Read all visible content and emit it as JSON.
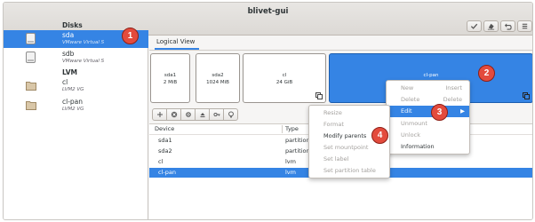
{
  "window": {
    "title": "blivet-gui"
  },
  "headerbar_buttons": [
    {
      "name": "apply-icon"
    },
    {
      "name": "clear-queue-icon"
    },
    {
      "name": "undo-icon"
    },
    {
      "name": "menu-icon"
    }
  ],
  "sidebar": {
    "disks_heading": "Disks",
    "lvm_heading": "LVM",
    "disks": [
      {
        "name": "sda",
        "sub": "VMware Virtual S",
        "icon": "disk-icon",
        "selected": true
      },
      {
        "name": "sdb",
        "sub": "VMware Virtual S",
        "icon": "disk-icon",
        "selected": false
      }
    ],
    "lvm": [
      {
        "name": "cl",
        "sub": "LVM2 VG",
        "icon": "folder-icon",
        "selected": false
      },
      {
        "name": "cl-pan",
        "sub": "LVM2 VG",
        "icon": "folder-icon",
        "selected": false
      }
    ]
  },
  "logical_view": {
    "tab_label": "Logical View",
    "partitions": [
      {
        "name": "sda1",
        "size": "2 MiB"
      },
      {
        "name": "sda2",
        "size": "1024 MiB"
      },
      {
        "name": "cl",
        "size": "24 GiB"
      },
      {
        "name": "cl-pan",
        "size": "",
        "selected": true
      }
    ]
  },
  "toolbar": {
    "buttons": [
      {
        "name": "add-icon"
      },
      {
        "name": "delete-icon"
      },
      {
        "name": "edit-icon"
      },
      {
        "name": "unmount-icon"
      },
      {
        "name": "decrypt-icon"
      },
      {
        "name": "information-icon"
      }
    ]
  },
  "device_table": {
    "columns": [
      "Device",
      "Type"
    ],
    "rows": [
      {
        "device": "sda1",
        "type": "partition",
        "selected": false
      },
      {
        "device": "sda2",
        "type": "partition",
        "selected": false
      },
      {
        "device": "cl",
        "type": "lvm",
        "selected": false
      },
      {
        "device": "cl-pan",
        "type": "lvm",
        "selected": true
      }
    ]
  },
  "context_menu": {
    "items": [
      {
        "label": "New",
        "accel": "Insert",
        "disabled": true
      },
      {
        "label": "Delete",
        "accel": "Delete",
        "disabled": true
      },
      {
        "label": "Edit",
        "accel": "",
        "disabled": false,
        "active": true,
        "submenu": true
      },
      {
        "label": "Unmount",
        "accel": "",
        "disabled": true
      },
      {
        "label": "Unlock",
        "accel": "",
        "disabled": true
      },
      {
        "label": "Information",
        "accel": "",
        "disabled": false
      }
    ]
  },
  "edit_submenu": {
    "items": [
      {
        "label": "Resize",
        "disabled": true
      },
      {
        "label": "Format",
        "disabled": true
      },
      {
        "label": "Modify parents",
        "disabled": false
      },
      {
        "label": "Set mountpoint",
        "disabled": true
      },
      {
        "label": "Set label",
        "disabled": true
      },
      {
        "label": "Set partition table",
        "disabled": true
      }
    ]
  },
  "badges": [
    "1",
    "2",
    "3",
    "4"
  ],
  "colors": {
    "accent": "#3584e4",
    "badge": "#e34b3d",
    "headerbar": "#dcd9d5"
  }
}
